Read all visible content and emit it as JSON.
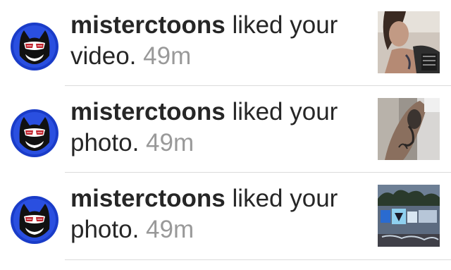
{
  "notifications": [
    {
      "username": "misterctoons",
      "action": "liked your",
      "object": "video.",
      "time": "49m",
      "avatar_icon": "cat-avatar-icon",
      "thumbnail": "tattoo-portrait-thumbnail"
    },
    {
      "username": "misterctoons",
      "action": "liked your",
      "object": "photo.",
      "time": "49m",
      "avatar_icon": "cat-avatar-icon",
      "thumbnail": "arm-tattoo-thumbnail"
    },
    {
      "username": "misterctoons",
      "action": "liked your",
      "object": "photo.",
      "time": "49m",
      "avatar_icon": "cat-avatar-icon",
      "thumbnail": "graffiti-wall-thumbnail"
    }
  ],
  "colors": {
    "text": "#262626",
    "timestamp": "#999999",
    "divider": "#dbdbdb",
    "avatar_ring": "#1a3cc8"
  }
}
